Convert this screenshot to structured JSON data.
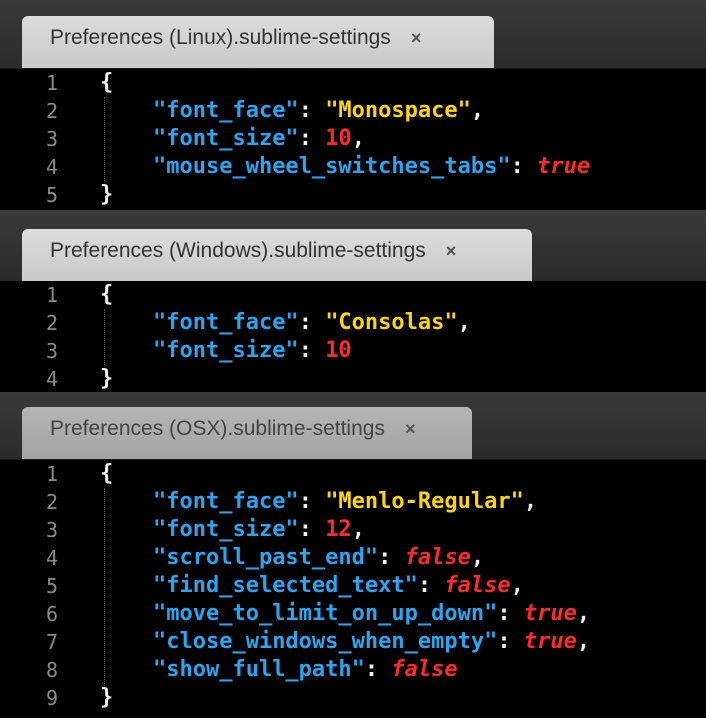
{
  "panels": [
    {
      "tab_title": "Preferences (Linux).sublime-settings",
      "close_glyph": "×",
      "lines": [
        {
          "num": "1",
          "kind": "open",
          "text": "{"
        },
        {
          "num": "2",
          "kind": "kv",
          "key": "\"font_face\"",
          "value": "\"Monospace\"",
          "vtype": "str",
          "trail": ","
        },
        {
          "num": "3",
          "kind": "kv",
          "key": "\"font_size\"",
          "value": "10",
          "vtype": "num",
          "trail": ","
        },
        {
          "num": "4",
          "kind": "kv",
          "key": "\"mouse_wheel_switches_tabs\"",
          "value": "true",
          "vtype": "bool",
          "trail": ""
        },
        {
          "num": "5",
          "kind": "close",
          "text": "}"
        }
      ]
    },
    {
      "tab_title": "Preferences (Windows).sublime-settings",
      "close_glyph": "×",
      "lines": [
        {
          "num": "1",
          "kind": "open",
          "text": "{"
        },
        {
          "num": "2",
          "kind": "kv",
          "key": "\"font_face\"",
          "value": "\"Consolas\"",
          "vtype": "str",
          "trail": ","
        },
        {
          "num": "3",
          "kind": "kv",
          "key": "\"font_size\"",
          "value": "10",
          "vtype": "num",
          "trail": ""
        },
        {
          "num": "4",
          "kind": "close",
          "text": "}"
        }
      ]
    },
    {
      "tab_title": "Preferences (OSX).sublime-settings",
      "close_glyph": "×",
      "lines": [
        {
          "num": "1",
          "kind": "open",
          "text": "{"
        },
        {
          "num": "2",
          "kind": "kv",
          "key": "\"font_face\"",
          "value": "\"Menlo-Regular\"",
          "vtype": "str",
          "trail": ","
        },
        {
          "num": "3",
          "kind": "kv",
          "key": "\"font_size\"",
          "value": "12",
          "vtype": "num",
          "trail": ","
        },
        {
          "num": "4",
          "kind": "kv",
          "key": "\"scroll_past_end\"",
          "value": "false",
          "vtype": "bool",
          "trail": ","
        },
        {
          "num": "5",
          "kind": "kv",
          "key": "\"find_selected_text\"",
          "value": "false",
          "vtype": "bool",
          "trail": ","
        },
        {
          "num": "6",
          "kind": "kv",
          "key": "\"move_to_limit_on_up_down\"",
          "value": "true",
          "vtype": "bool",
          "trail": ","
        },
        {
          "num": "7",
          "kind": "kv",
          "key": "\"close_windows_when_empty\"",
          "value": "true",
          "vtype": "bool",
          "trail": ","
        },
        {
          "num": "8",
          "kind": "kv",
          "key": "\"show_full_path\"",
          "value": "false",
          "vtype": "bool",
          "trail": ""
        },
        {
          "num": "9",
          "kind": "close",
          "text": "}"
        }
      ]
    }
  ],
  "colors": {
    "background": "#000000",
    "key": "#2aa6f0",
    "string": "#ffd700",
    "number": "#ff2b2b",
    "boolean": "#ff2b2b",
    "line_number": "#8a8a8a"
  }
}
